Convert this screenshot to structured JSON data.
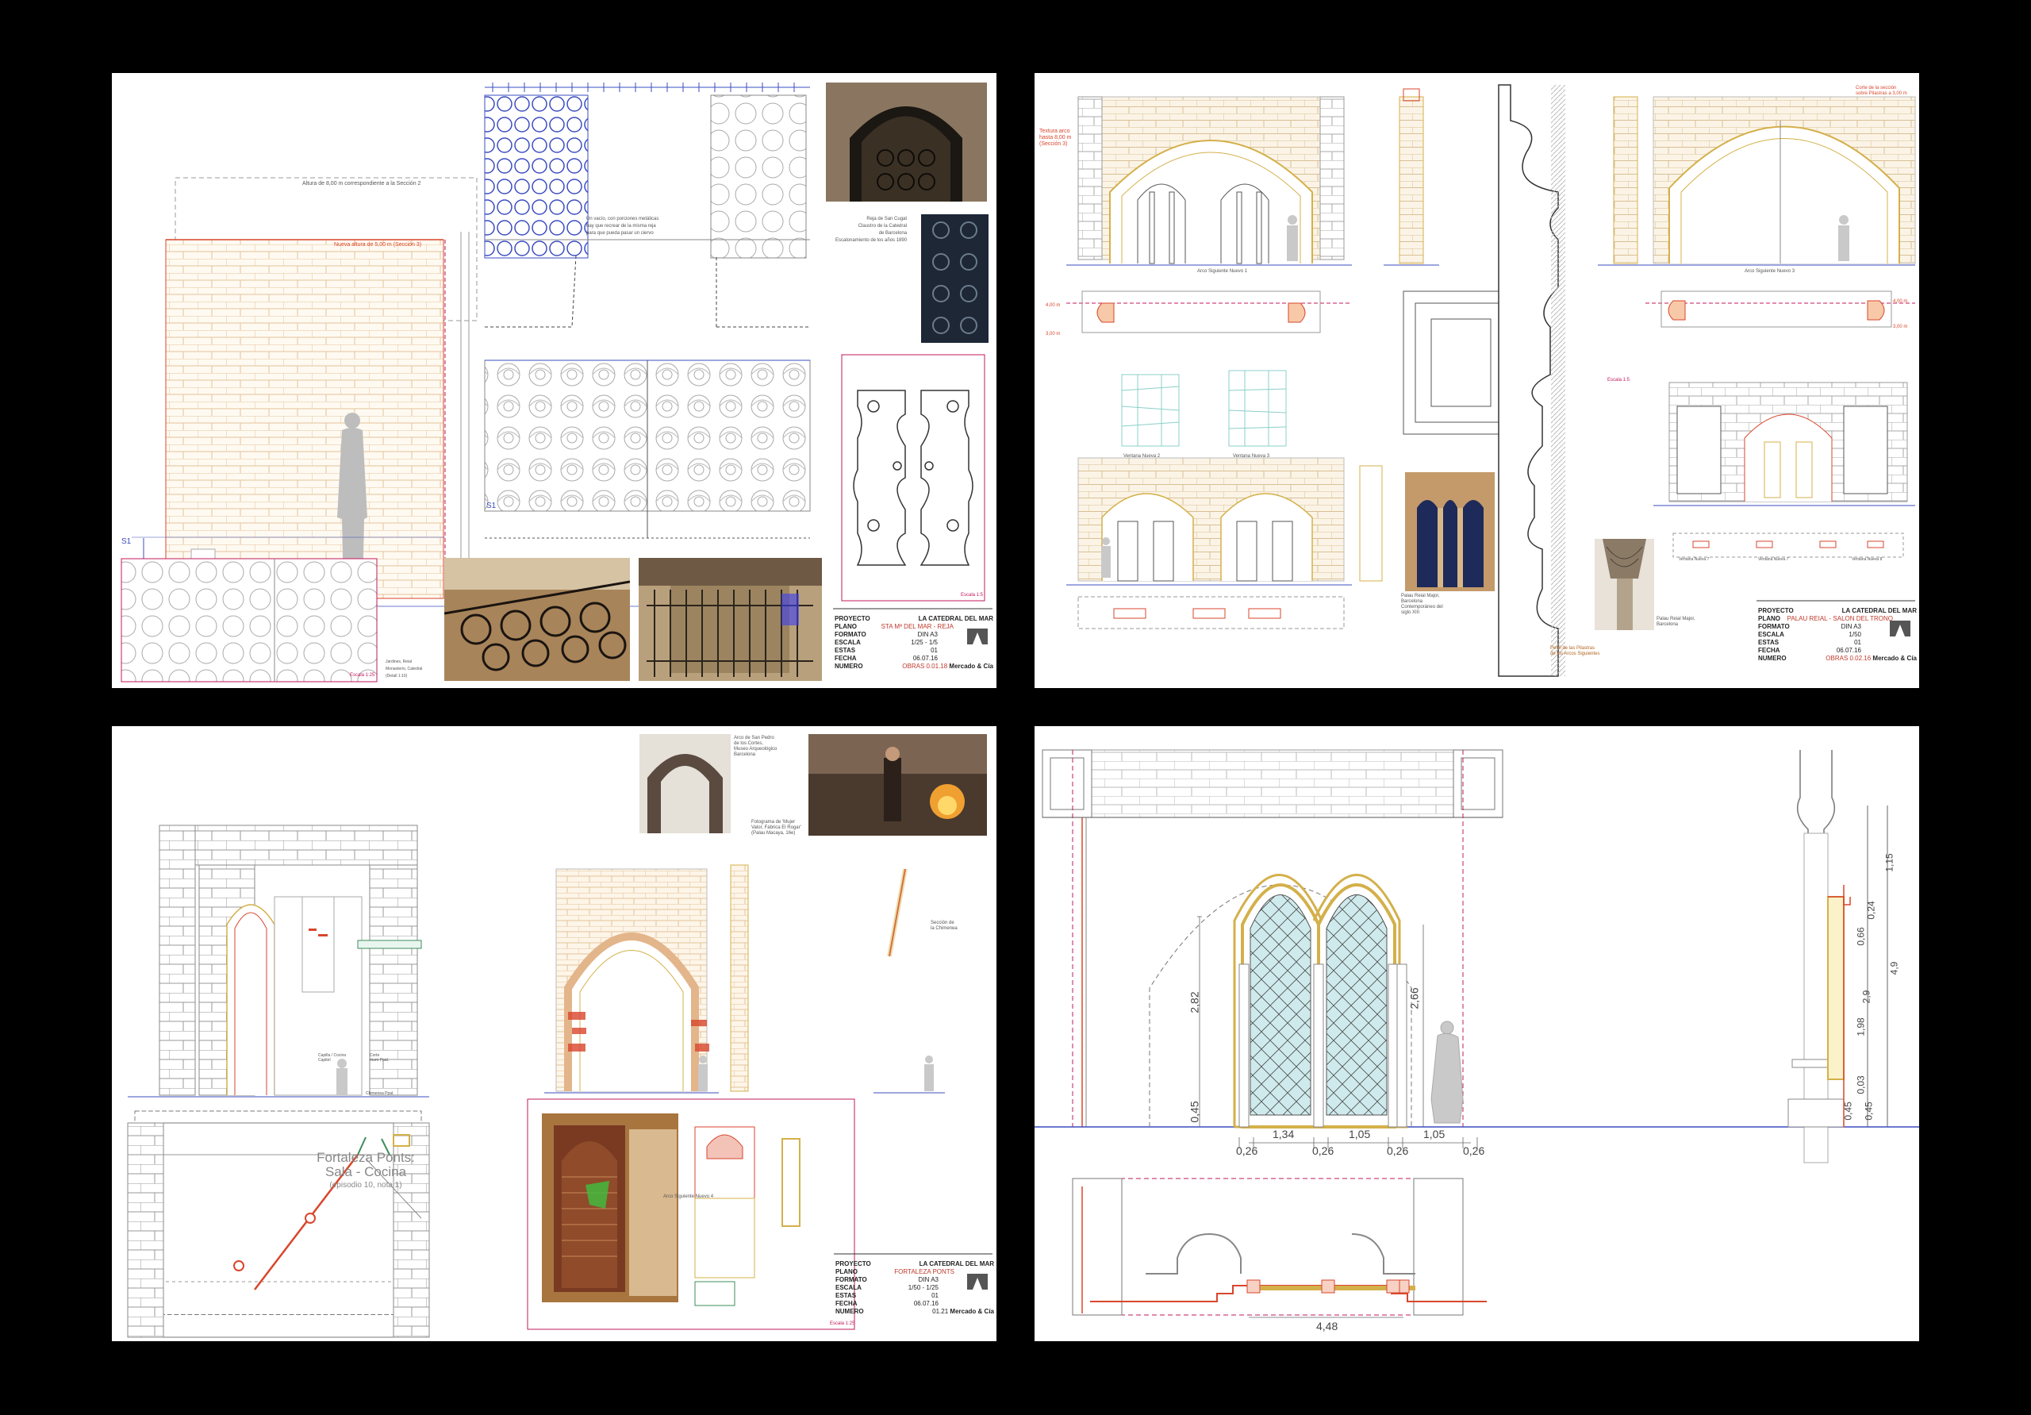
{
  "sheets": [
    {
      "id": "s1",
      "annotations": {
        "a1": "Altura de 8,00 m correspondiente a la Sección 2",
        "a2": "Nueva altura de 5,00 m (Sección 3)",
        "scale_label": "Escala 1:25",
        "photo_caption": "Reja de San Cugat\nClaustro de la Catedral\nde Barcelona\nEscalonamiento de los años 1890",
        "grille_note": "Un vacío, con porciones metálicas\nhay que recrear de la misma reja\npara que pueda pasar un ciervo",
        "bottom_caption": "Jardines, Reial\nMonasterio, Catedral\n(Detall 1:10)",
        "hinge_scale": "Escala 1:5",
        "s1": "S1"
      },
      "titleblock": {
        "proyecto_k": "PROYECTO",
        "proyecto_v": "LA CATEDRAL DEL MAR",
        "plano_k": "PLANO",
        "plano_v": "STA Mª DEL MAR - REJA",
        "formato_k": "FORMATO",
        "formato_v": "DIN A3",
        "escala_k": "ESCALA",
        "escala_v": "1/25 - 1/5",
        "estas_k": "ESTAS",
        "estas_v": "01",
        "fecha_k": "FECHA",
        "fecha_v": "06.07.16",
        "numero_k": "NUMERO",
        "numero_v": "OBRAS 0.01.18",
        "firm": "Mercado & Cía"
      }
    },
    {
      "id": "s2",
      "annotations": {
        "a1": "Textura arco\nhasta 8,00 m\n(Sección 3)",
        "a2": "Corte de la sección\nsobre Pilastras a 3,00 m",
        "elev1": "Arco Siguiente Nuevo 1",
        "elev2": "Arco Siguiente Nuevo 3",
        "dim_l1": "4,00 m",
        "dim_l2": "3,00 m",
        "dim_r1": "4,00 m",
        "dim_r2": "3,00 m",
        "v1": "Ventana Nueva 2",
        "v2": "Ventana Nueva 3",
        "photo1": "Palau Reial Major,\nBarcelona\nContemporáneo del\nsiglo XIII",
        "photo2": "Palau Reial Major,\nBarcelona",
        "profile": "Perfil de las Pilastras\nde los Arcos Siguientes",
        "esc": "Escala 1:5",
        "v3": "Ventana Nueva 7",
        "v4": "Ventana Nueva 7",
        "v5": "Ventana Nueva 8"
      },
      "titleblock": {
        "proyecto_k": "PROYECTO",
        "proyecto_v": "LA CATEDRAL DEL MAR",
        "plano_k": "PLANO",
        "plano_v": "PALAU REIAL - SALON DEL TRONO",
        "formato_k": "FORMATO",
        "formato_v": "DIN A3",
        "escala_k": "ESCALA",
        "escala_v": "1/50",
        "estas_k": "ESTAS",
        "estas_v": "01",
        "fecha_k": "FECHA",
        "fecha_v": "06.07.16",
        "numero_k": "NUMERO",
        "numero_v": "OBRAS 0.02.16",
        "firm": "Mercado & Cía"
      }
    },
    {
      "id": "s3",
      "annotations": {
        "photo1": "Arco de San Pedro\nde los Cortes,\nMuseo Arqueológico\nBarcelona",
        "photo2": "Fotograma de 'Mujer\nValor, Fábrica El Rogar'\n(Palau Macaya, 16e)",
        "plan_title": "Fortaleza Ponts:\nSala - Cocina",
        "plan_sub": "(episodio 10, nota 1)",
        "arch": "Arco Siguiente Nuevo 4",
        "sect": "Sección de\nla Chimenea",
        "esc": "Escala 1:25",
        "e1": "Capilla / Cocina\nCapitel",
        "e2": "Corte\nmuro Ppal.",
        "e3": "Chimenea Ppal."
      },
      "titleblock": {
        "proyecto_k": "PROYECTO",
        "proyecto_v": "LA CATEDRAL DEL MAR",
        "plano_k": "PLANO",
        "plano_v": "FORTALEZA PONTS",
        "formato_k": "FORMATO",
        "formato_v": "DIN A3",
        "escala_k": "ESCALA",
        "escala_v": "1/50 - 1/25",
        "estas_k": "ESTAS",
        "estas_v": "01",
        "fecha_k": "FECHA",
        "fecha_v": "06.07.16",
        "numero_k": "NUMERO",
        "numero_v": "01.21",
        "firm": "Mercado & Cía"
      }
    },
    {
      "id": "s4",
      "dims": {
        "h1": "2,82",
        "h2": "2,66",
        "h3": "0,45",
        "w1": "0,26",
        "w2": "1,34",
        "w3": "0,26",
        "w4": "1,05",
        "w5": "0,26",
        "w6": "1,05",
        "w7": "0,26",
        "total": "4,48",
        "r1": "1,15",
        "r2": "0,24",
        "r3": "0,66",
        "r4": "4,9",
        "r5": "2,9",
        "r6": "1,98",
        "r7": "0,03",
        "r8": "0,45",
        "r9": "0,45"
      }
    }
  ],
  "colors": {
    "brick_line": "#e8c79a",
    "stone_line": "#bdbdbd",
    "red_line": "#d9462c",
    "pink_line": "#c2185b",
    "blue_line": "#3b4cc0",
    "glass": "#bfe4e6",
    "gold": "#d4b04a"
  }
}
